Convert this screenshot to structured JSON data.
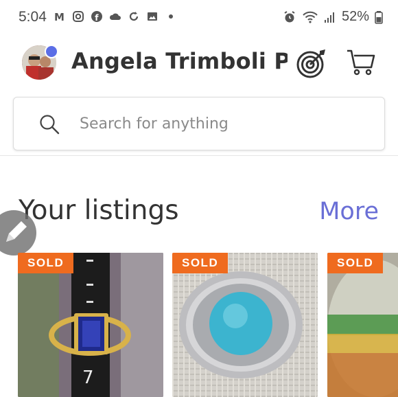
{
  "status_bar": {
    "time": "5:04",
    "battery": "52%",
    "left_icons": [
      "gmail-icon",
      "instagram-icon",
      "facebook-icon",
      "cloud-icon",
      "sync-icon",
      "gallery-icon",
      "dot-icon"
    ],
    "right_icons": [
      "alarm-icon",
      "wifi-icon",
      "signal-icon",
      "battery-icon"
    ]
  },
  "header": {
    "user_name": "Angela Trimboli Por",
    "notification_dot_color": "#5b6ee6"
  },
  "search": {
    "placeholder": "Search for anything"
  },
  "listings": {
    "title": "Your listings",
    "more_label": "More",
    "items": [
      {
        "badge": "SOLD",
        "subject": "sapphire gold ring"
      },
      {
        "badge": "SOLD",
        "subject": "turquoise halo ring"
      },
      {
        "badge": "SOLD",
        "subject": "glass paperweight"
      }
    ]
  },
  "colors": {
    "accent": "#6a6fd6",
    "sold_badge": "#ef6b1f",
    "text": "#333333"
  }
}
